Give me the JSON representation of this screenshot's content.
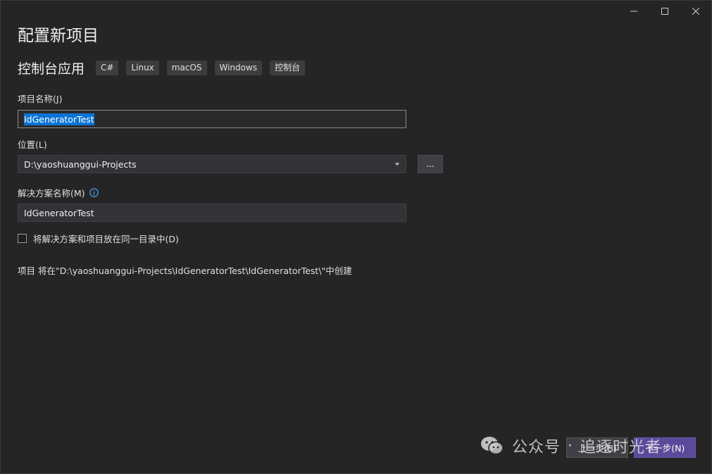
{
  "window": {
    "controls": {
      "minimize": "minimize",
      "maximize": "maximize",
      "close": "close"
    }
  },
  "page_title": "配置新项目",
  "template": {
    "name": "控制台应用",
    "tags": [
      "C#",
      "Linux",
      "macOS",
      "Windows",
      "控制台"
    ]
  },
  "project_name": {
    "label": "项目名称(J)",
    "value": "IdGeneratorTest"
  },
  "location": {
    "label": "位置(L)",
    "value": "D:\\yaoshuanggui-Projects",
    "browse_label": "..."
  },
  "solution_name": {
    "label": "解决方案名称(M)",
    "value": "IdGeneratorTest"
  },
  "same_directory": {
    "label": "将解决方案和项目放在同一目录中(D)",
    "checked": false
  },
  "path_note": "项目 将在\"D:\\yaoshuanggui-Projects\\IdGeneratorTest\\IdGeneratorTest\\\"中创建",
  "buttons": {
    "back": "上一步(B)",
    "next": "下一步(N)"
  },
  "watermark": {
    "platform": "公众号",
    "separator": "·",
    "author": "追逐时光者"
  },
  "colors": {
    "background": "#252526",
    "input_bg": "#333337",
    "selection": "#0a74d6",
    "primary_button": "#5b4a9a",
    "info_icon": "#4aa3e8"
  }
}
